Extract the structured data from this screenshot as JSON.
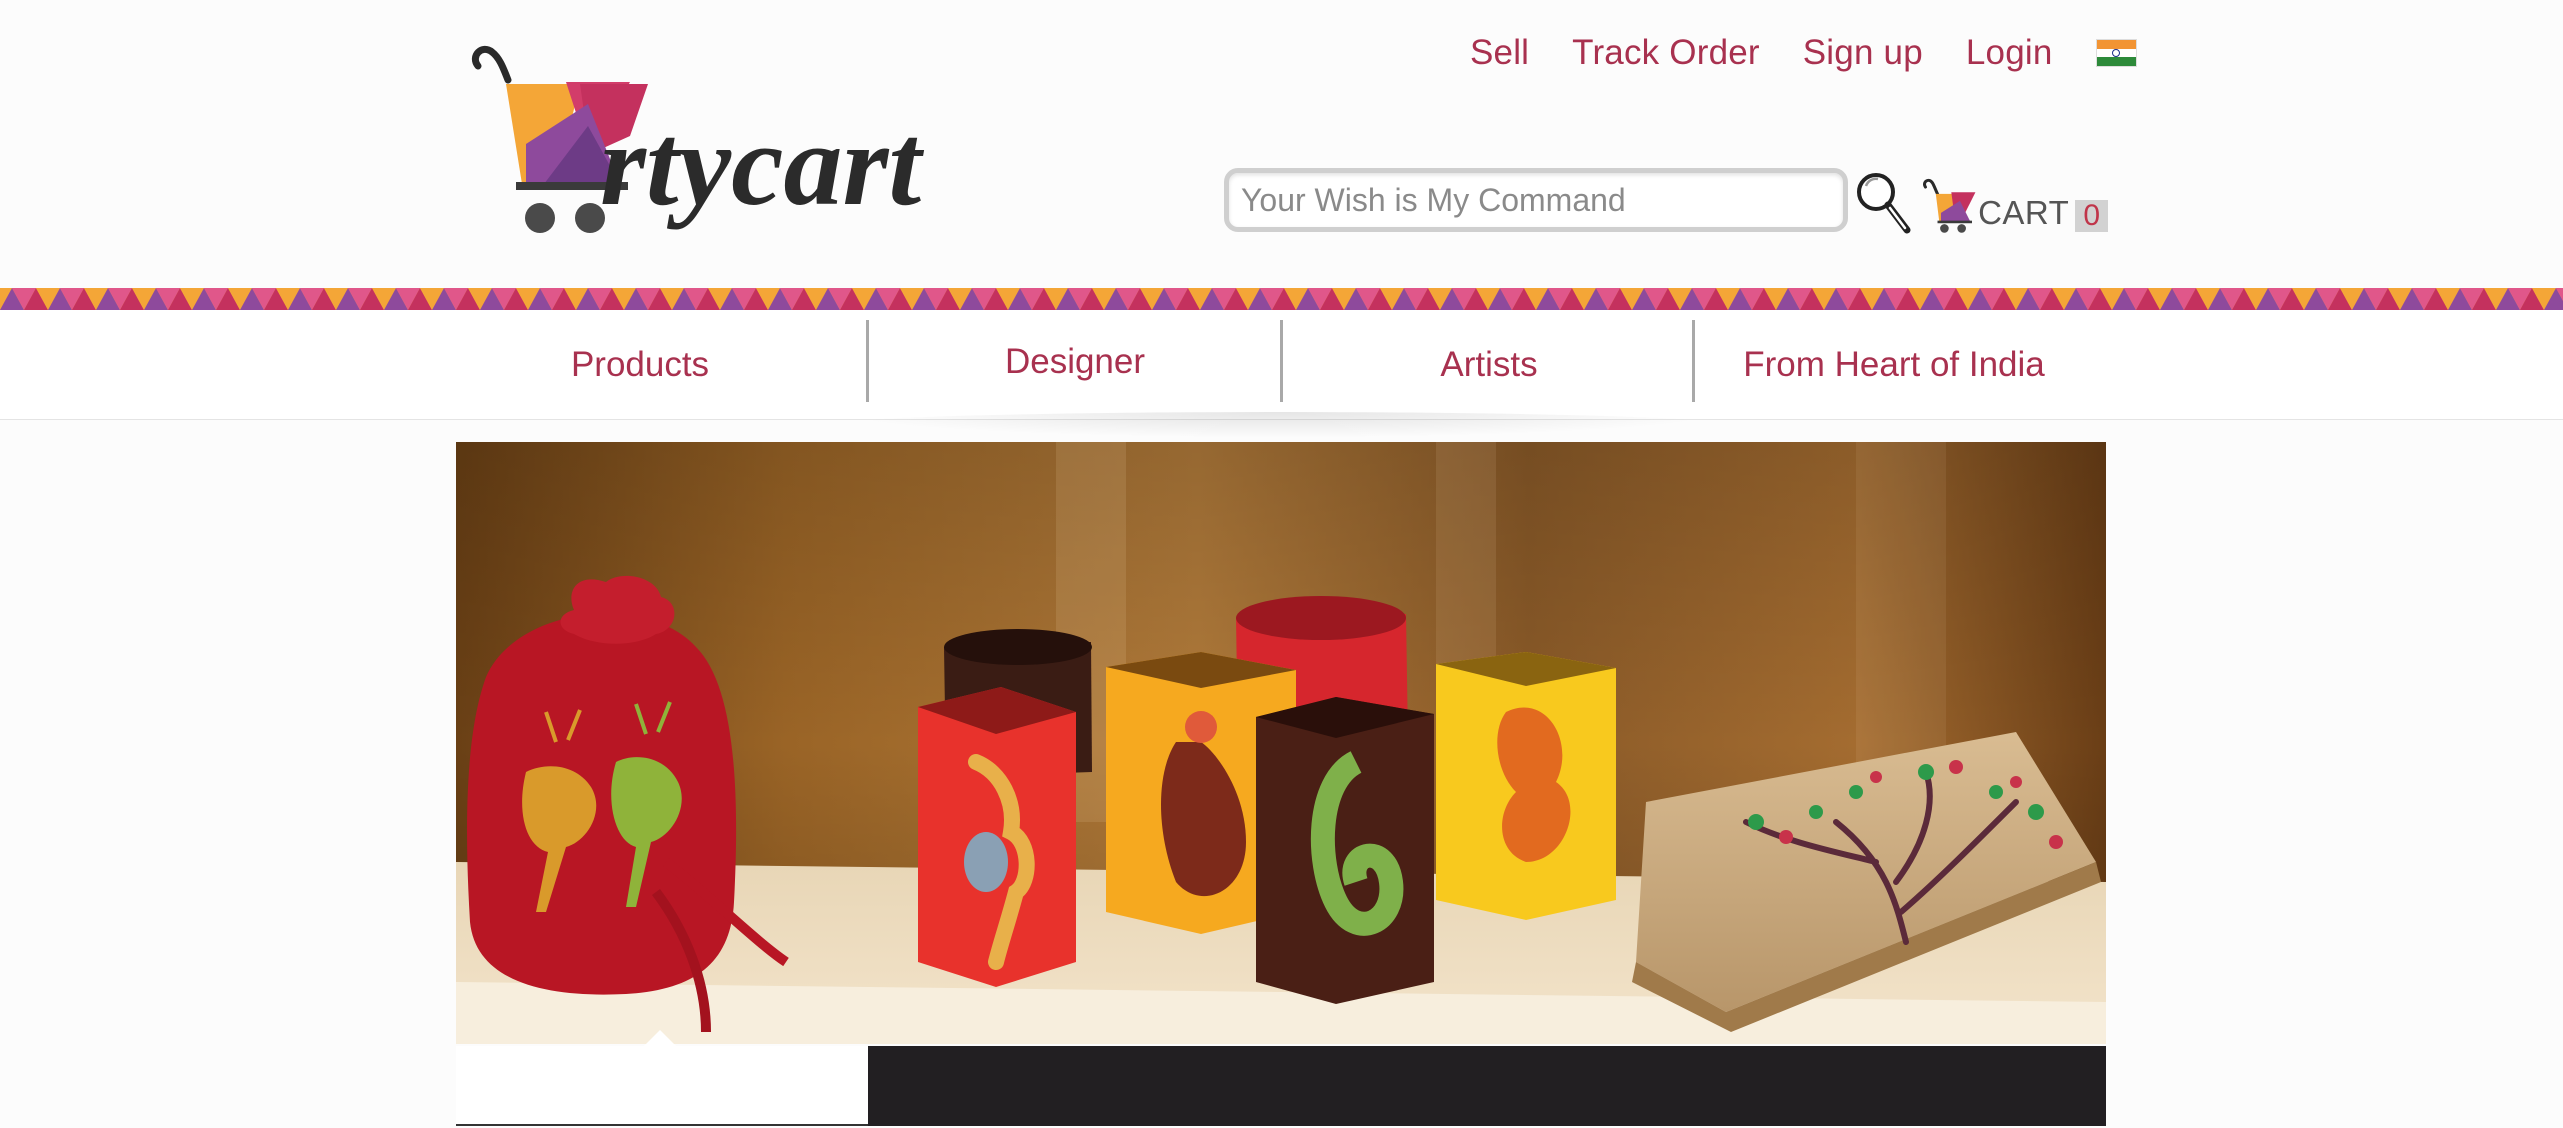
{
  "brand": {
    "name": "Artycart",
    "logo_text": "rtycart",
    "colors": {
      "accent": "#a8314f",
      "orange": "#f4a637",
      "purple": "#8e4a9c",
      "magenta": "#c4315e",
      "dark": "#221f22"
    }
  },
  "header": {
    "links": [
      {
        "label": "Sell",
        "name": "sell-link"
      },
      {
        "label": "Track Order",
        "name": "track-order-link"
      },
      {
        "label": "Sign up",
        "name": "sign-up-link"
      },
      {
        "label": "Login",
        "name": "login-link"
      }
    ],
    "flag_icon": "india-flag-icon"
  },
  "search": {
    "placeholder": "Your Wish is My Command",
    "value": "",
    "icon": "magnifier-icon"
  },
  "cart": {
    "label": "CART",
    "count": "0",
    "icon": "cart-icon"
  },
  "nav": {
    "items": [
      {
        "label": "Products"
      },
      {
        "label": "Designer"
      },
      {
        "label": "Artists"
      },
      {
        "label": "From Heart of India"
      }
    ]
  },
  "banner": {
    "subject": "hand-painted craft products"
  }
}
